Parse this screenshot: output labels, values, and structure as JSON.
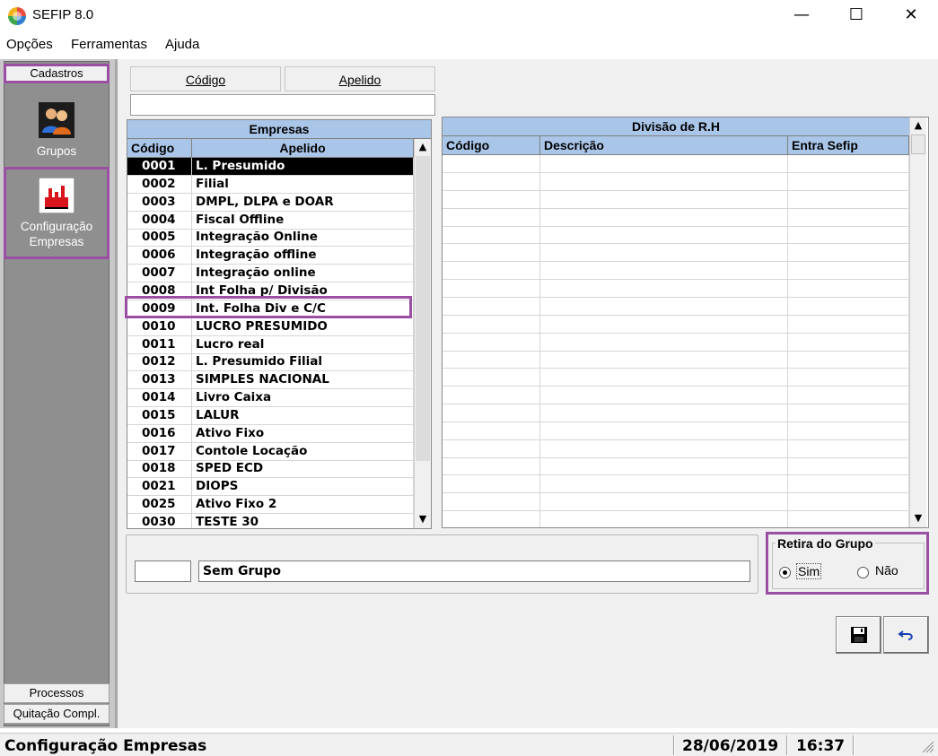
{
  "window": {
    "title": "SEFIP 8.0",
    "minimize": "—",
    "maximize": "☐",
    "close": "✕"
  },
  "menu": {
    "opcoes": "Opções",
    "ferramentas": "Ferramentas",
    "ajuda": "Ajuda"
  },
  "nav": {
    "cadastros": "Cadastros",
    "grupos": "Grupos",
    "config_line1": "Configuração",
    "config_line2": "Empresas",
    "processos": "Processos",
    "quitacao": "Quitação Compl."
  },
  "tabs": {
    "codigo": "Código",
    "apelido": "Apelido"
  },
  "empresas": {
    "title": "Empresas",
    "col_codigo": "Código",
    "col_apelido": "Apelido",
    "rows": [
      {
        "codigo": "0001",
        "apelido": "L. Presumido"
      },
      {
        "codigo": "0002",
        "apelido": "Filial"
      },
      {
        "codigo": "0003",
        "apelido": "DMPL, DLPA e DOAR"
      },
      {
        "codigo": "0004",
        "apelido": "Fiscal Offline"
      },
      {
        "codigo": "0005",
        "apelido": "Integração Online"
      },
      {
        "codigo": "0006",
        "apelido": "Integração offline"
      },
      {
        "codigo": "0007",
        "apelido": "Integração online"
      },
      {
        "codigo": "0008",
        "apelido": "Int Folha p/ Divisão"
      },
      {
        "codigo": "0009",
        "apelido": "Int. Folha Div e C/C"
      },
      {
        "codigo": "0010",
        "apelido": "LUCRO PRESUMIDO"
      },
      {
        "codigo": "0011",
        "apelido": "Lucro real"
      },
      {
        "codigo": "0012",
        "apelido": "L. Presumido Filial"
      },
      {
        "codigo": "0013",
        "apelido": "SIMPLES NACIONAL"
      },
      {
        "codigo": "0014",
        "apelido": "Livro Caixa"
      },
      {
        "codigo": "0015",
        "apelido": "LALUR"
      },
      {
        "codigo": "0016",
        "apelido": "Ativo Fixo"
      },
      {
        "codigo": "0017",
        "apelido": "Contole Locação"
      },
      {
        "codigo": "0018",
        "apelido": "SPED ECD"
      },
      {
        "codigo": "0021",
        "apelido": "DIOPS"
      },
      {
        "codigo": "0025",
        "apelido": "Ativo Fixo 2"
      },
      {
        "codigo": "0030",
        "apelido": "TESTE 30"
      }
    ]
  },
  "divisao": {
    "title": "Divisão de R.H",
    "col_codigo": "Código",
    "col_descricao": "Descrição",
    "col_entra": "Entra Sefip"
  },
  "grupo": {
    "codigo": "",
    "nome": "Sem Grupo"
  },
  "retira": {
    "legend": "Retira do Grupo",
    "sim": "Sim",
    "nao": "Não",
    "selected": "Sim"
  },
  "status": {
    "screen": "Configuração Empresas",
    "date": "28/06/2019",
    "time": "16:37"
  },
  "colors": {
    "header_blue": "#a9c5e8",
    "highlight_purple": "#9b4fa3",
    "nav_gray": "#8f8f8f"
  }
}
